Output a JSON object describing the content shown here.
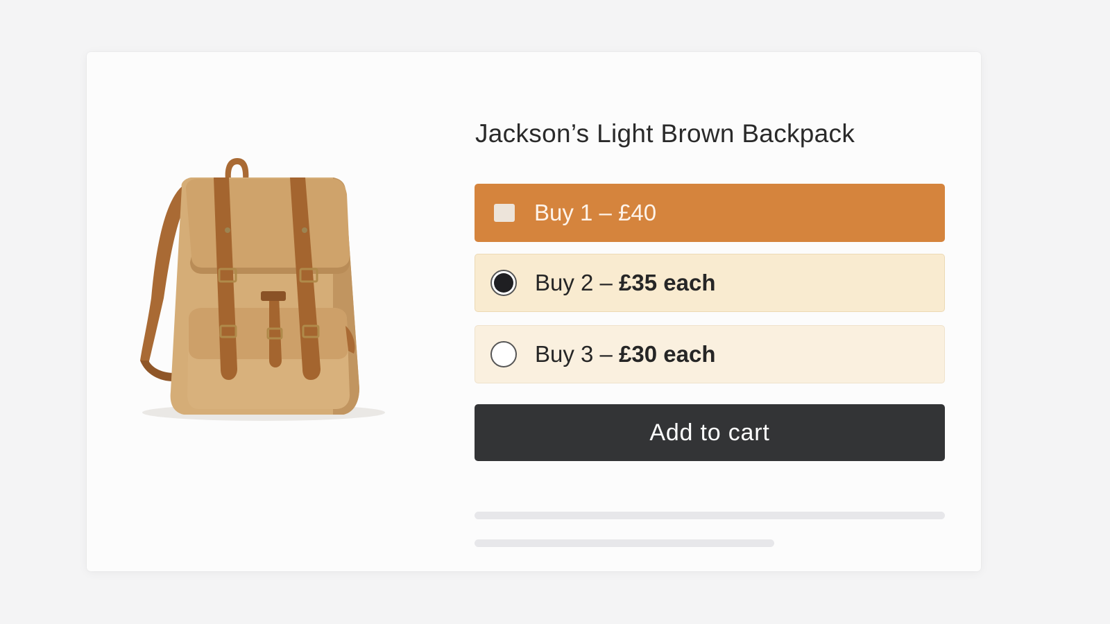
{
  "product": {
    "title": "Jackson’s Light Brown Backpack",
    "image_icon": "backpack-image"
  },
  "options": [
    {
      "prefix": "Buy 1 – £40",
      "bold": "",
      "state": "highlighted",
      "control": "checkbox"
    },
    {
      "prefix": "Buy 2 – ",
      "bold": "£35 each",
      "state": "selected",
      "control": "radio"
    },
    {
      "prefix": "Buy 3 – ",
      "bold": "£30 each",
      "state": "unselected",
      "control": "radio"
    }
  ],
  "cart": {
    "button_label": "Add to cart"
  },
  "colors": {
    "accent": "#d5843d",
    "selected_bg": "#f9ebd0",
    "option_bg": "#faf0df",
    "button_bg": "#333436"
  }
}
